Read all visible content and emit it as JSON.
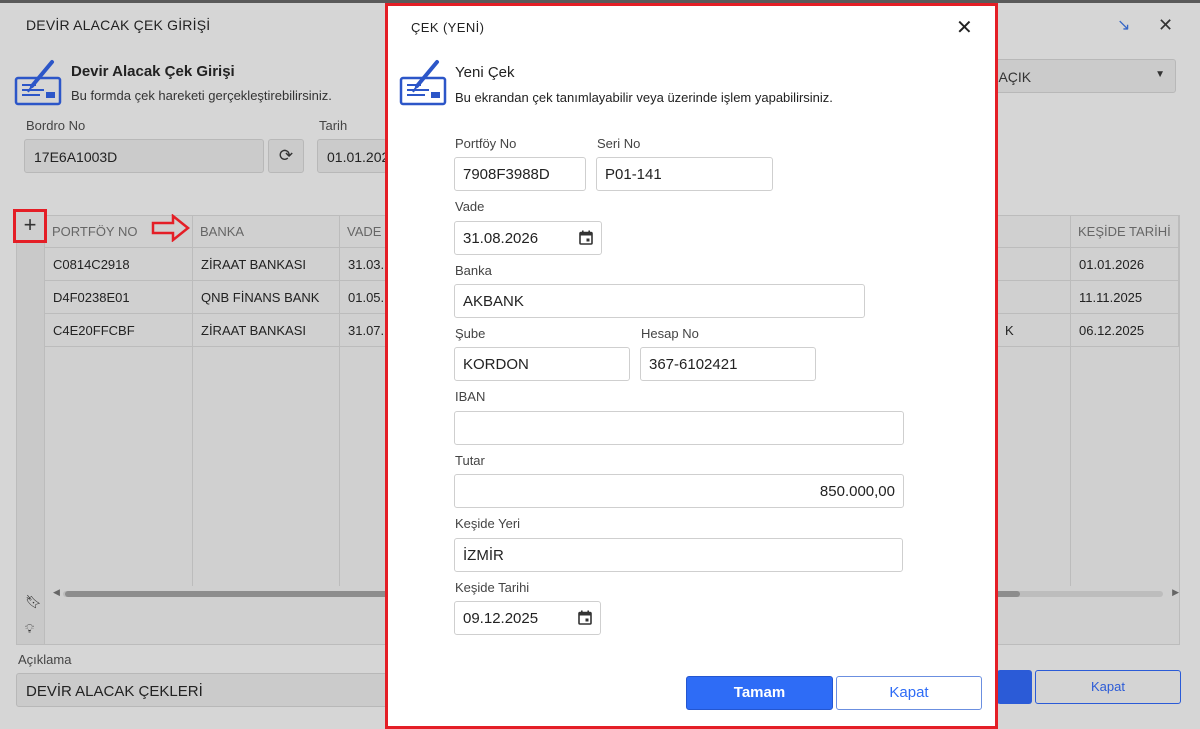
{
  "background": {
    "title": "DEVİR ALACAK ÇEK GİRİŞİ",
    "header": "Devir Alacak Çek Girişi",
    "subtitle": "Bu formda çek hareketi gerçekleştirebilirsiniz.",
    "bordro_label": "Bordro No",
    "bordro_value": "17E6A1003D",
    "tarih_label": "Tarih",
    "tarih_value": "01.01.202",
    "status_select": "E AÇIK",
    "columns": [
      "PORTFÖY NO",
      "BANKA",
      "VADE",
      "KEŞİDE TARİHİ"
    ],
    "rows": [
      {
        "portfoy": "C0814C2918",
        "banka": "ZİRAAT BANKASI",
        "vade": "31.03.",
        "extra": "",
        "keside": "01.01.2026"
      },
      {
        "portfoy": "D4F0238E01",
        "banka": "QNB FİNANS BANK",
        "vade": "01.05.",
        "extra": "",
        "keside": "11.11.2025"
      },
      {
        "portfoy": "C4E20FFCBF",
        "banka": "ZİRAAT BANKASI",
        "vade": "31.07.",
        "extra": "K",
        "keside": "06.12.2025"
      }
    ],
    "aciklama_label": "Açıklama",
    "aciklama_value": "DEVİR ALACAK ÇEKLERİ",
    "kapat_label": "Kapat"
  },
  "modal": {
    "title": "ÇEK (YENİ)",
    "header": "Yeni Çek",
    "subtitle": "Bu ekrandan çek tanımlayabilir veya üzerinde işlem yapabilirsiniz.",
    "fields": {
      "portfoy_label": "Portföy No",
      "portfoy_value": "7908F3988D",
      "seri_label": "Seri No",
      "seri_value": "P01-141",
      "vade_label": "Vade",
      "vade_value": "31.08.2026",
      "banka_label": "Banka",
      "banka_value": "AKBANK",
      "sube_label": "Şube",
      "sube_value": "KORDON",
      "hesap_label": "Hesap No",
      "hesap_value": "367-6102421",
      "iban_label": "IBAN",
      "iban_value": "",
      "tutar_label": "Tutar",
      "tutar_value": "850.000,00",
      "keside_yeri_label": "Keşide Yeri",
      "keside_yeri_value": "İZMİR",
      "keside_tarihi_label": "Keşide Tarihi",
      "keside_tarihi_value": "09.12.2025"
    },
    "ok_label": "Tamam",
    "close_label": "Kapat"
  },
  "icons": {
    "close": "close-icon",
    "add": "plus-icon",
    "refresh": "refresh-icon",
    "calendar": "calendar-icon",
    "bookmark": "bookmark-icon",
    "bulb": "lightbulb-icon",
    "logo": "check-document-icon"
  },
  "colors": {
    "primary": "#2e6cf6",
    "annotation": "#e41e26",
    "logo": "#2c56c8"
  }
}
